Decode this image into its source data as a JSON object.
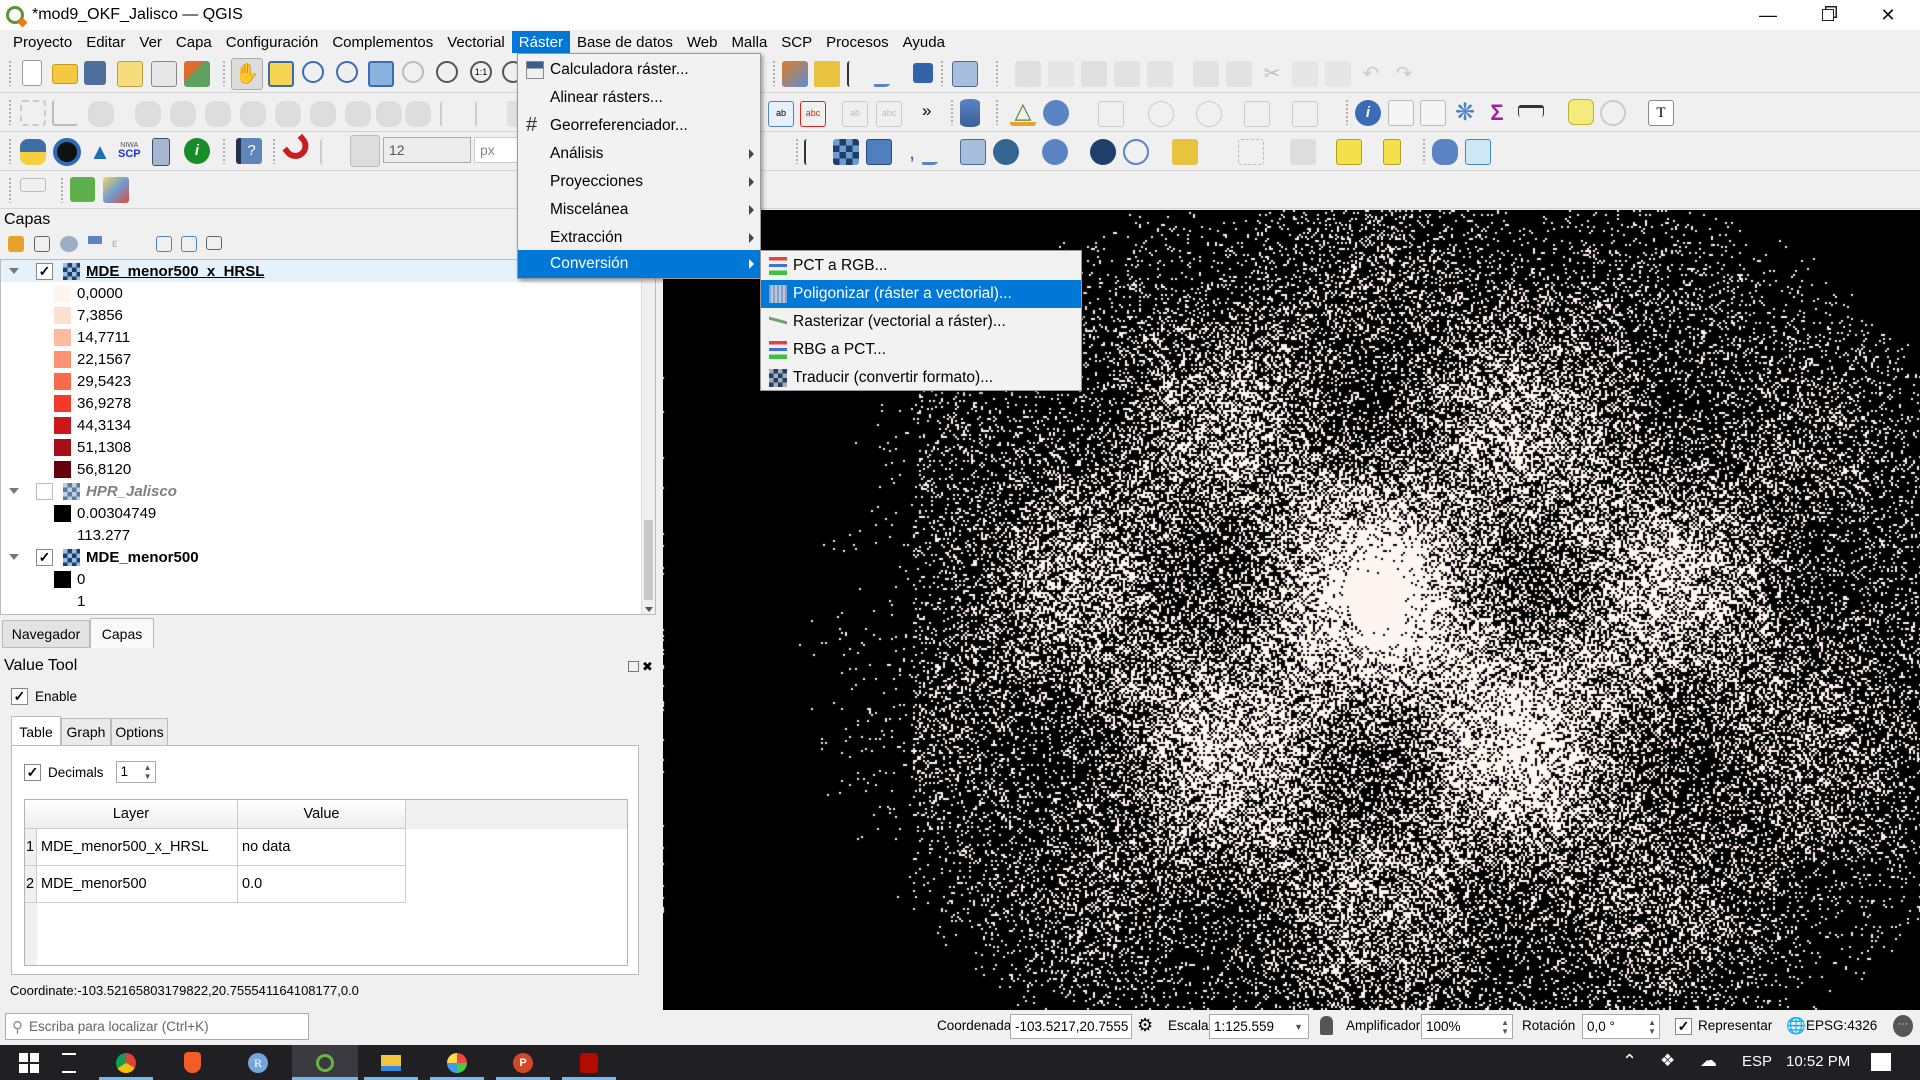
{
  "window": {
    "title": "*mod9_OKF_Jalisco — QGIS",
    "minimize_icon": "minimize-icon",
    "maximize_icon": "restore-icon",
    "close_icon": "close-icon"
  },
  "menubar": {
    "items": [
      "Proyecto",
      "Editar",
      "Ver",
      "Capa",
      "Configuración",
      "Complementos",
      "Vectorial",
      "Ráster",
      "Base de datos",
      "Web",
      "Malla",
      "SCP",
      "Procesos",
      "Ayuda"
    ],
    "active": "Ráster"
  },
  "toolbar": {
    "symbol_size_value": "12",
    "symbol_unit": "px",
    "overflow_label": "»"
  },
  "raster_menu": {
    "items": [
      {
        "label": "Calculadora ráster...",
        "icon": "raster-calculator-icon",
        "submenu": false
      },
      {
        "label": "Alinear rásters...",
        "icon": "",
        "submenu": false
      },
      {
        "label": "Georreferenciador...",
        "icon": "georeferencer-icon",
        "submenu": false
      },
      {
        "label": "Análisis",
        "icon": "",
        "submenu": true
      },
      {
        "label": "Proyecciones",
        "icon": "",
        "submenu": true
      },
      {
        "label": "Miscelánea",
        "icon": "",
        "submenu": true
      },
      {
        "label": "Extracción",
        "icon": "",
        "submenu": true
      },
      {
        "label": "Conversión",
        "icon": "",
        "submenu": true,
        "highlighted": true
      }
    ]
  },
  "conversion_submenu": {
    "items": [
      {
        "label": "PCT a RGB...",
        "icon": "pct-to-rgb-icon"
      },
      {
        "label": "Poligonizar (ráster a vectorial)...",
        "icon": "polygonize-icon",
        "highlighted": true
      },
      {
        "label": "Rasterizar (vectorial a ráster)...",
        "icon": "rasterize-icon"
      },
      {
        "label": "RBG a PCT...",
        "icon": "rgb-to-pct-icon"
      },
      {
        "label": "Traducir (convertir formato)...",
        "icon": "translate-icon"
      }
    ]
  },
  "layers_panel": {
    "title": "Capas",
    "layers": [
      {
        "name": "MDE_menor500_x_HRSL",
        "visible": true,
        "selected": true,
        "style": "bold-underline",
        "legend": [
          {
            "label": "0,0000",
            "color": "#fff5f0"
          },
          {
            "label": "7,3856",
            "color": "#fee0d2"
          },
          {
            "label": "14,7711",
            "color": "#fcbba1"
          },
          {
            "label": "22,1567",
            "color": "#fc9272"
          },
          {
            "label": "29,5423",
            "color": "#fb6a4a"
          },
          {
            "label": "36,9278",
            "color": "#ef3b2c"
          },
          {
            "label": "44,3134",
            "color": "#cb181d"
          },
          {
            "label": "51,1308",
            "color": "#a50f15"
          },
          {
            "label": "56,8120",
            "color": "#67000d"
          }
        ]
      },
      {
        "name": "HPR_Jalisco",
        "visible": false,
        "style": "italic-gray",
        "legend": [
          {
            "label": "0.00304749",
            "color": "#000000"
          },
          {
            "label": "113.277",
            "color": "#ffffff"
          }
        ]
      },
      {
        "name": "MDE_menor500",
        "visible": true,
        "style": "bold",
        "legend": [
          {
            "label": "0",
            "color": "#000000"
          },
          {
            "label": "1",
            "color": "#ffffff"
          }
        ]
      }
    ]
  },
  "dock_tabs": [
    "Navegador",
    "Capas"
  ],
  "dock_tabs_active": "Capas",
  "value_tool": {
    "title": "Value Tool",
    "enable_label": "Enable",
    "enable_checked": true,
    "tabs": [
      "Table",
      "Graph",
      "Options"
    ],
    "active_tab": "Table",
    "decimals_label": "Decimals",
    "decimals_checked": true,
    "decimals_value": "1",
    "columns": [
      "Layer",
      "Value"
    ],
    "rows": [
      {
        "index": "1",
        "layer": "MDE_menor500_x_HRSL",
        "value": "no data"
      },
      {
        "index": "2",
        "layer": "MDE_menor500",
        "value": "0.0"
      }
    ],
    "coordinate": "Coordinate:-103.52165803179822,20.755541164108177,0.0"
  },
  "statusbar": {
    "locator_placeholder": "Escriba para localizar (Ctrl+K)",
    "coordinate_label": "Coordenada",
    "coordinate_value": "-103.5217,20.7555",
    "scale_label": "Escala",
    "scale_value": "1:125.559",
    "magnifier_label": "Amplificador",
    "magnifier_value": "100%",
    "rotation_label": "Rotación",
    "rotation_value": "0,0 °",
    "render_label": "Representar",
    "render_checked": true,
    "crs_label": "EPSG:4326"
  },
  "taskbar": {
    "apps": [
      "Start",
      "Task View",
      "Chrome",
      "Brave",
      "R",
      "QGIS",
      "File Explorer",
      "Paint",
      "PowerPoint",
      "Acrobat"
    ],
    "active_app": "QGIS",
    "language": "ESP",
    "time": "10:52 PM"
  }
}
